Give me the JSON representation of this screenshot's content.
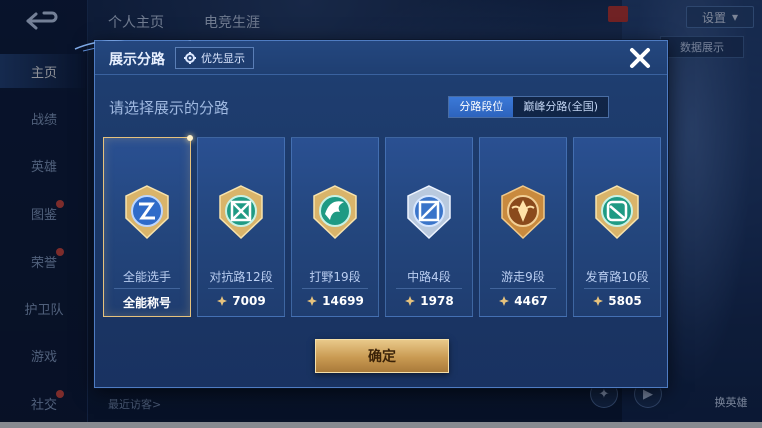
{
  "sidebar": {
    "items": [
      {
        "label": "主页",
        "active": true
      },
      {
        "label": "战绩"
      },
      {
        "label": "英雄"
      },
      {
        "label": "图鉴"
      },
      {
        "label": "荣誉"
      },
      {
        "label": "护卫队"
      },
      {
        "label": "游戏"
      },
      {
        "label": "社交"
      }
    ]
  },
  "topbar": {
    "tabs": [
      "个人主页",
      "电竞生涯"
    ],
    "settings_label": "设置",
    "display_label": "数据展示"
  },
  "bottom": {
    "recent_visitors": "最近访客>",
    "swap_hero": "换英雄"
  },
  "modal": {
    "title": "展示分路",
    "priority_label": "优先显示",
    "subtitle": "请选择展示的分路",
    "toggle": [
      "分路段位",
      "巅峰分路(全国)"
    ],
    "confirm_label": "确定",
    "cards": [
      {
        "rank": "全能选手",
        "value": "全能称号",
        "selected": true,
        "emblem": "all-round-emblem"
      },
      {
        "rank": "对抗路12段",
        "value": "7009",
        "emblem": "clash-lane-emblem"
      },
      {
        "rank": "打野19段",
        "value": "14699",
        "emblem": "jungle-emblem"
      },
      {
        "rank": "中路4段",
        "value": "1978",
        "emblem": "mid-lane-emblem"
      },
      {
        "rank": "游走9段",
        "value": "4467",
        "emblem": "roam-emblem"
      },
      {
        "rank": "发育路10段",
        "value": "5805",
        "emblem": "farm-lane-emblem"
      }
    ]
  },
  "colors": {
    "accent_gold": "#e6c27d",
    "toggle_active": "#3b79d8",
    "modal_bg": "#1f3f72"
  }
}
